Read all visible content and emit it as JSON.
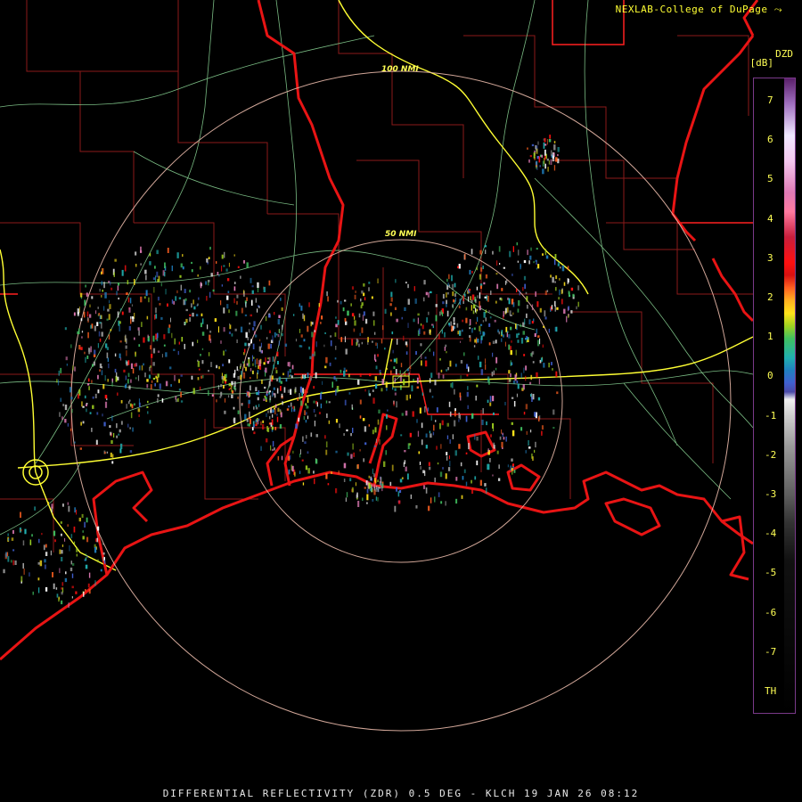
{
  "header": {
    "credit": "NEXLAB-College of DuPage",
    "logo_glyph": "⤳"
  },
  "range_rings": {
    "outer_label": "100 NMI",
    "inner_label": "50 NMI"
  },
  "colorbar": {
    "product_code": "DZD",
    "unit": "[dB]",
    "ticks": [
      "7",
      "6",
      "5",
      "4",
      "3",
      "2",
      "1",
      "0",
      "-1",
      "-2",
      "-3",
      "-4",
      "-5",
      "-6",
      "-7",
      "TH"
    ]
  },
  "footer": {
    "caption": "DIFFERENTIAL REFLECTIVITY (ZDR) 0.5 DEG - KLCH 19 JAN 26 08:12"
  },
  "colors": {
    "coastline": "#e81414",
    "state_border": "#ff1e1e",
    "county_border": "#8b1a1a",
    "highways": "#8fdc9a",
    "interstate": "#ffff33",
    "range_ring": "#e8b8a8",
    "label": "#ffff55"
  },
  "icons": {
    "logo": "nexlab-logo-icon",
    "radar_site": "radar-site-icon"
  }
}
